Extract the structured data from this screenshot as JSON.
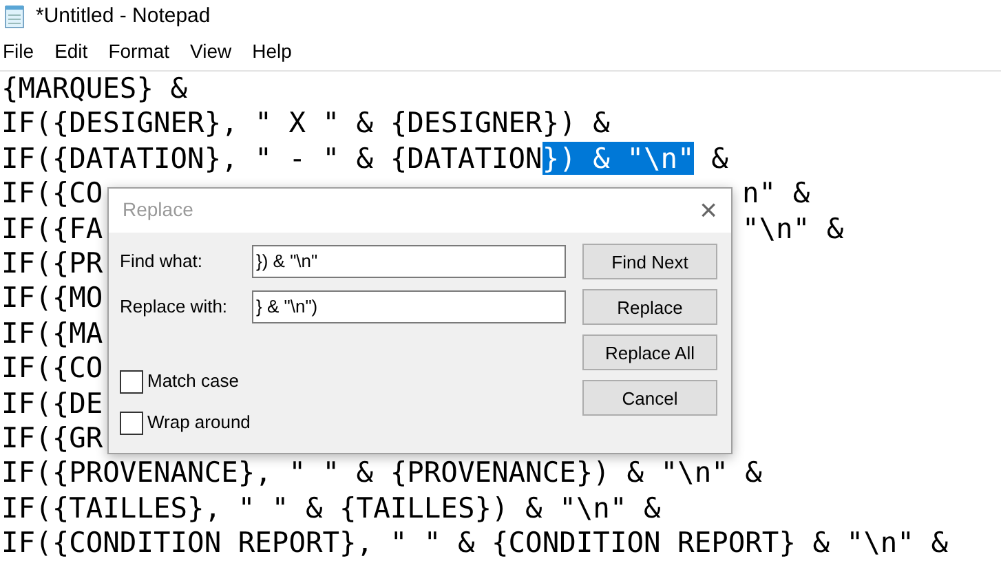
{
  "window": {
    "title": "*Untitled - Notepad"
  },
  "menu": [
    "File",
    "Edit",
    "Format",
    "View",
    "Help"
  ],
  "editor_lines": [
    {
      "segments": [
        {
          "text": "{MARQUES} &",
          "selected": false
        }
      ]
    },
    {
      "segments": [
        {
          "text": "IF({DESIGNER}, \" X \" & {DESIGNER}) &",
          "selected": false
        }
      ]
    },
    {
      "segments": [
        {
          "text": "IF({DATATION}, \" - \" & {DATATION",
          "selected": false
        },
        {
          "text": "}) & \"\\n\"",
          "selected": true
        },
        {
          "text": " &",
          "selected": false
        }
      ]
    },
    {
      "segments": [
        {
          "text": "IF({CO",
          "selected": false
        }
      ],
      "tail": "n\" &"
    },
    {
      "segments": [
        {
          "text": "IF({FA",
          "selected": false
        }
      ],
      "tail": "\"\\n\" &"
    },
    {
      "segments": [
        {
          "text": "IF({PR",
          "selected": false
        }
      ]
    },
    {
      "segments": [
        {
          "text": "IF({MO",
          "selected": false
        }
      ]
    },
    {
      "segments": [
        {
          "text": "IF({MA",
          "selected": false
        }
      ]
    },
    {
      "segments": [
        {
          "text": "IF({CO",
          "selected": false
        }
      ]
    },
    {
      "segments": [
        {
          "text": "IF({DE",
          "selected": false
        }
      ]
    },
    {
      "segments": [
        {
          "text": "IF({GR",
          "selected": false
        }
      ]
    },
    {
      "segments": [
        {
          "text": "IF({PROVENANCE}, \" \" & {PROVENANCE}) & \"\\n\" &",
          "selected": false
        }
      ]
    },
    {
      "segments": [
        {
          "text": "IF({TAILLES}, \" \" & {TAILLES}) & \"\\n\" &",
          "selected": false
        }
      ]
    },
    {
      "segments": [
        {
          "text": "IF({CONDITION REPORT}, \" \" & {CONDITION REPORT} & \"\\n\" &",
          "selected": false
        }
      ]
    }
  ],
  "dialog": {
    "title": "Replace",
    "close": "×",
    "fields": [
      {
        "label": "Find what:",
        "value": "}) & \"\\n\""
      },
      {
        "label": "Replace with:",
        "value": "} & \"\\n\")"
      }
    ],
    "buttons": [
      "Find Next",
      "Replace",
      "Replace All",
      "Cancel"
    ],
    "checkboxes": [
      {
        "label": "Match case",
        "checked": false
      },
      {
        "label": "Wrap around",
        "checked": false
      }
    ]
  }
}
